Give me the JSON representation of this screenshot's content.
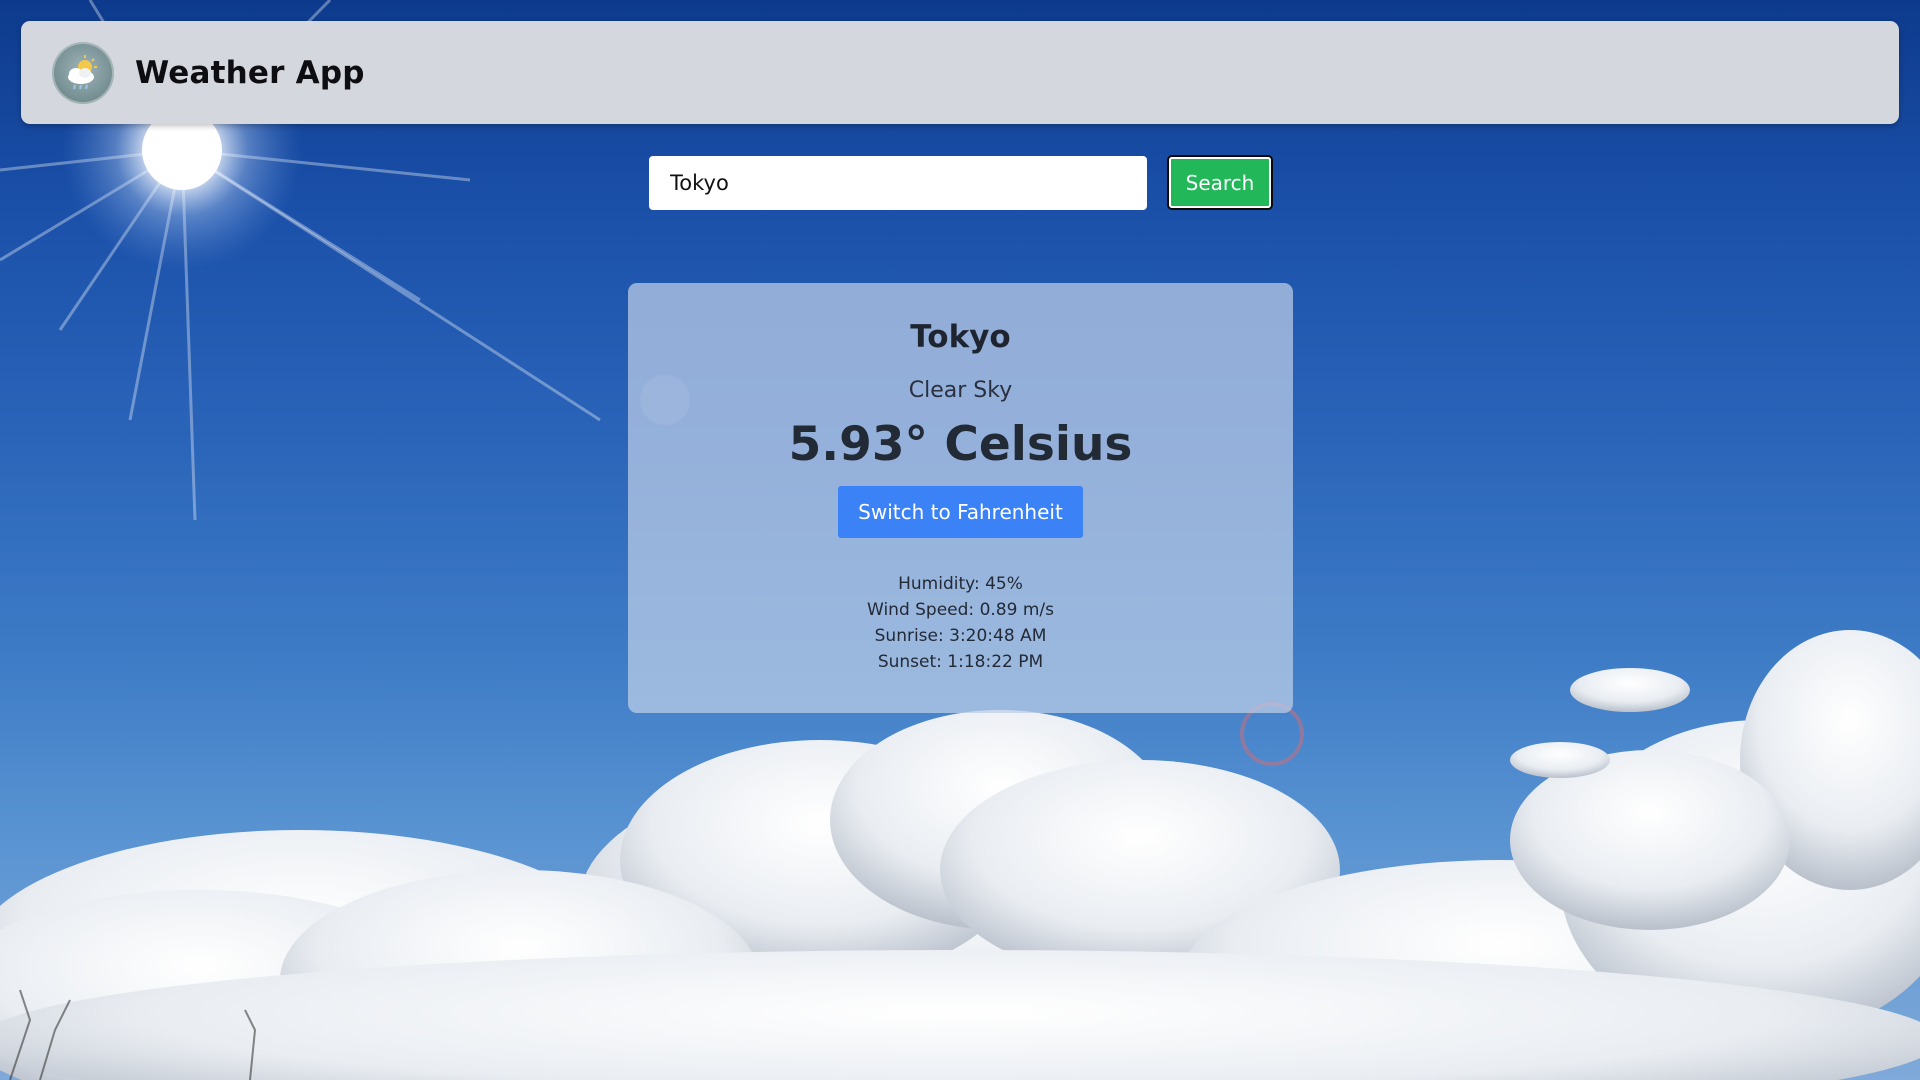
{
  "header": {
    "title": "Weather App",
    "logo_icon": "weather-logo-icon"
  },
  "search": {
    "value": "Tokyo",
    "button_label": "Search"
  },
  "weather": {
    "city": "Tokyo",
    "condition": "Clear Sky",
    "temperature": "5.93° Celsius",
    "toggle_label": "Switch to Fahrenheit",
    "humidity": "Humidity: 45%",
    "wind_speed": "Wind Speed: 0.89 m/s",
    "sunrise": "Sunrise: 3:20:48 AM",
    "sunset": "Sunset: 1:18:22 PM"
  },
  "colors": {
    "search_button": "#22b85a",
    "unit_button": "#3b82f6",
    "header_bg": "#d4d7de"
  }
}
